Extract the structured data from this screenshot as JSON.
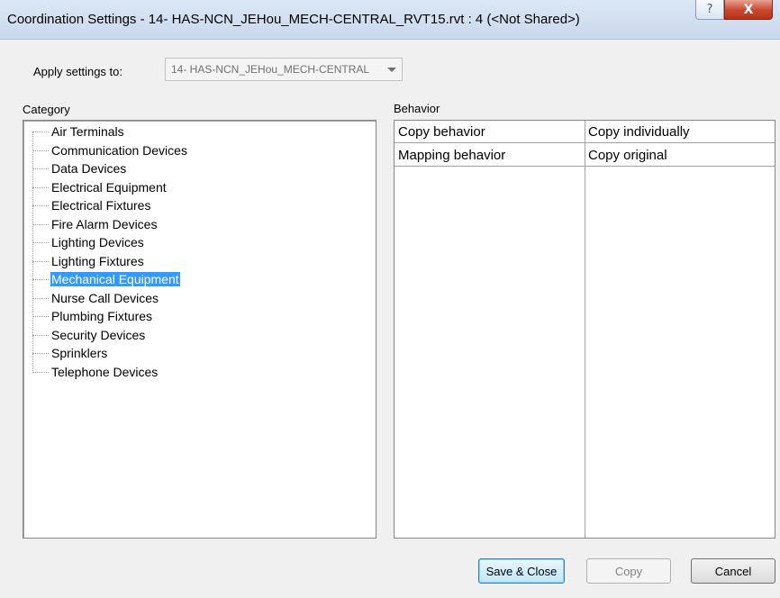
{
  "window": {
    "title": "Coordination Settings - 14- HAS-NCN_JEHou_MECH-CENTRAL_RVT15.rvt : 4 (<Not Shared>)",
    "help_glyph": "?",
    "close_glyph": "X"
  },
  "apply": {
    "label": "Apply settings to:",
    "selected_value": "14- HAS-NCN_JEHou_MECH-CENTRAL"
  },
  "category": {
    "label": "Category",
    "items": [
      {
        "label": "Air Terminals",
        "selected": false
      },
      {
        "label": "Communication Devices",
        "selected": false
      },
      {
        "label": "Data Devices",
        "selected": false
      },
      {
        "label": "Electrical Equipment",
        "selected": false
      },
      {
        "label": "Electrical Fixtures",
        "selected": false
      },
      {
        "label": "Fire Alarm Devices",
        "selected": false
      },
      {
        "label": "Lighting Devices",
        "selected": false
      },
      {
        "label": "Lighting Fixtures",
        "selected": false
      },
      {
        "label": "Mechanical Equipment",
        "selected": true
      },
      {
        "label": "Nurse Call Devices",
        "selected": false
      },
      {
        "label": "Plumbing Fixtures",
        "selected": false
      },
      {
        "label": "Security Devices",
        "selected": false
      },
      {
        "label": "Sprinklers",
        "selected": false
      },
      {
        "label": "Telephone Devices",
        "selected": false
      }
    ]
  },
  "behavior": {
    "label": "Behavior",
    "rows": [
      {
        "name": "Copy behavior",
        "value": "Copy individually"
      },
      {
        "name": "Mapping behavior",
        "value": "Copy original"
      }
    ]
  },
  "buttons": {
    "save_close": "Save & Close",
    "copy": "Copy",
    "cancel": "Cancel"
  },
  "colors": {
    "selection": "#3399ff",
    "titlebar": "#c9d9ec",
    "close_button": "#c9452c"
  }
}
